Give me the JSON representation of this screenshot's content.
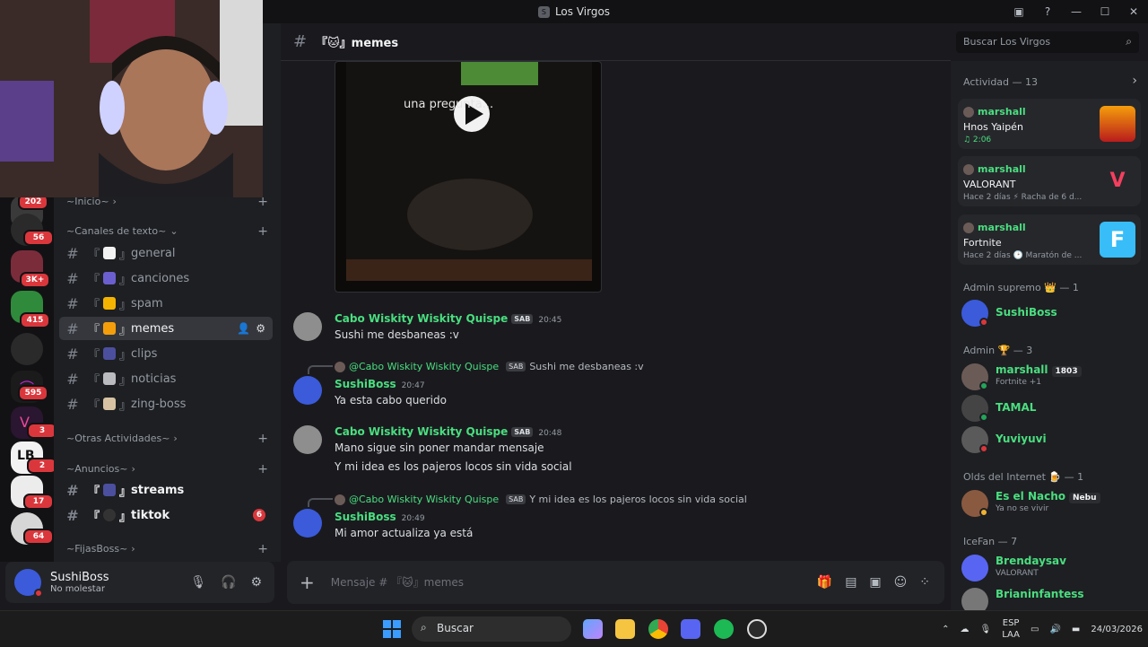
{
  "window": {
    "title": "Los Virgos",
    "server_icon_letter": "S"
  },
  "servers": [
    {
      "badge": "202"
    },
    {
      "badge": "56"
    },
    {
      "badge": "3K+"
    },
    {
      "badge": "415"
    },
    {
      "badge": ""
    },
    {
      "badge": "595"
    },
    {
      "badge": "3"
    },
    {
      "badge": "2"
    },
    {
      "badge": "17"
    },
    {
      "badge": "64"
    }
  ],
  "sidebar": {
    "categories": {
      "inicio": "~Inicio~",
      "canales": "~Canales de texto~",
      "otras": "~Otras Actividades~",
      "anuncios": "~Anuncios~",
      "fijas": "~FijasBoss~"
    },
    "channels": [
      {
        "name": "general"
      },
      {
        "name": "canciones"
      },
      {
        "name": "spam"
      },
      {
        "name": "memes"
      },
      {
        "name": "clips"
      },
      {
        "name": "noticias"
      },
      {
        "name": "zing-boss"
      },
      {
        "name": "streams"
      },
      {
        "name": "tiktok",
        "badge": "6"
      }
    ]
  },
  "user": {
    "name": "SushiBoss",
    "status": "No molestar"
  },
  "header": {
    "channel": "『🐱』memes",
    "search_placeholder": "Buscar Los Virgos"
  },
  "video": {
    "caption": "una pregunta..."
  },
  "messages": [
    {
      "author": "Cabo Wiskity Wiskity Quispe",
      "tag": "SAB",
      "time": "20:45",
      "lines": [
        "Sushi me desbaneas :v"
      ]
    },
    {
      "reply_to": "@Cabo Wiskity Wiskity Quispe",
      "reply_tag": "SAB",
      "reply_text": "Sushi me desbaneas :v",
      "author": "SushiBoss",
      "time": "20:47",
      "lines": [
        "Ya esta cabo querido"
      ]
    },
    {
      "author": "Cabo Wiskity Wiskity Quispe",
      "tag": "SAB",
      "time": "20:48",
      "lines": [
        "Mano sigue sin poner mandar mensaje",
        "Y mi idea es los pajeros locos sin vida social"
      ]
    },
    {
      "reply_to": "@Cabo Wiskity Wiskity Quispe",
      "reply_tag": "SAB",
      "reply_text": "Y mi idea es los pajeros locos sin vida social",
      "author": "SushiBoss",
      "time": "20:49",
      "lines": [
        "Mi amor actualiza ya está"
      ]
    }
  ],
  "composer": {
    "placeholder": "Mensaje # 『🐱』memes"
  },
  "activity": {
    "header": "Actividad — 13",
    "cards": [
      {
        "user": "marshall",
        "title": "Hnos Yaipén",
        "sub": "♫ 2:06"
      },
      {
        "user": "marshall",
        "title": "VALORANT",
        "sub": "Hace 2 días  ⚡ Racha de 6 d..."
      },
      {
        "user": "marshall",
        "title": "Fortnite",
        "sub": "Hace 2 días  🕑 Maratón de ..."
      }
    ]
  },
  "member_groups": [
    {
      "label": "Admin supremo 👑 — 1",
      "members": [
        {
          "name": "SushiBoss",
          "sub": ""
        }
      ]
    },
    {
      "label": "Admin 🏆 — 3",
      "members": [
        {
          "name": "marshall",
          "badge": "1803",
          "sub": "Fortnite +1"
        },
        {
          "name": "TAMAL",
          "sub": ""
        },
        {
          "name": "Yuviyuvi",
          "sub": ""
        }
      ]
    },
    {
      "label": "Olds del Internet 🍺 — 1",
      "members": [
        {
          "name": "Es el Nacho",
          "badge": "Nebu",
          "sub": "Ya no se vivir"
        }
      ]
    },
    {
      "label": "IceFan — 7",
      "members": [
        {
          "name": "Brendaysav",
          "sub": "VALORANT"
        },
        {
          "name": "Brianinfantess",
          "sub": ""
        }
      ]
    }
  ],
  "taskbar": {
    "search": "Buscar",
    "lang1": "ESP",
    "lang2": "LAA",
    "date": "24/03/2026"
  },
  "colors": {
    "accent_green": "#4ade80",
    "badge_red": "#da373c",
    "background": "#1a1a1e"
  }
}
